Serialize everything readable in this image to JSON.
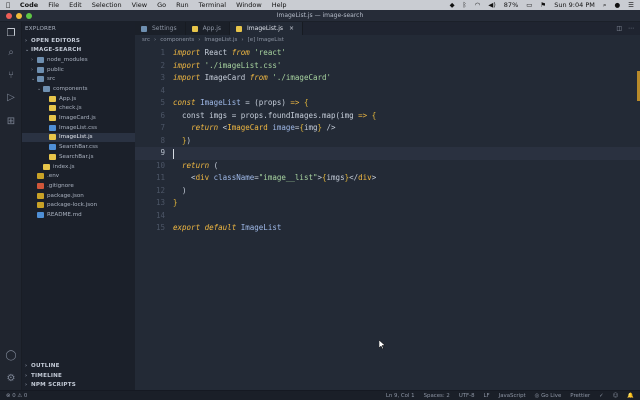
{
  "menubar": {
    "items": [
      "Code",
      "File",
      "Edit",
      "Selection",
      "View",
      "Go",
      "Run",
      "Terminal",
      "Window",
      "Help"
    ],
    "status": {
      "battery": "87%",
      "clock": "Sun 9:04 PM"
    }
  },
  "window": {
    "title": "ImageList.js — image-search"
  },
  "sidebar": {
    "explorer_title": "EXPLORER",
    "open_editors": "OPEN EDITORS",
    "project": "IMAGE-SEARCH",
    "tree": [
      {
        "label": "node_modules",
        "type": "folder",
        "depth": 1,
        "open": false,
        "color": "#6e8fb0"
      },
      {
        "label": "public",
        "type": "folder",
        "depth": 1,
        "open": false,
        "color": "#6e8fb0"
      },
      {
        "label": "src",
        "type": "folder",
        "depth": 1,
        "open": true,
        "color": "#6e8fb0"
      },
      {
        "label": "components",
        "type": "folder",
        "depth": 2,
        "open": true,
        "color": "#6e8fb0"
      },
      {
        "label": "App.js",
        "type": "js",
        "depth": 3,
        "color": "#e7c54a"
      },
      {
        "label": "check.js",
        "type": "js",
        "depth": 3,
        "color": "#e7c54a"
      },
      {
        "label": "ImageCard.js",
        "type": "js",
        "depth": 3,
        "color": "#e7c54a"
      },
      {
        "label": "ImageList.css",
        "type": "css",
        "depth": 3,
        "color": "#4f8fd6"
      },
      {
        "label": "ImageList.js",
        "type": "js",
        "depth": 3,
        "color": "#e7c54a",
        "selected": true
      },
      {
        "label": "SearchBar.css",
        "type": "css",
        "depth": 3,
        "color": "#4f8fd6"
      },
      {
        "label": "SearchBar.js",
        "type": "js",
        "depth": 3,
        "color": "#e7c54a"
      },
      {
        "label": "index.js",
        "type": "js",
        "depth": 2,
        "color": "#e7c54a"
      },
      {
        "label": ".env",
        "type": "env",
        "depth": 1,
        "color": "#c9a227"
      },
      {
        "label": ".gitignore",
        "type": "git",
        "depth": 1,
        "color": "#d0573a"
      },
      {
        "label": "package.json",
        "type": "json",
        "depth": 1,
        "color": "#c9a227"
      },
      {
        "label": "package-lock.json",
        "type": "json",
        "depth": 1,
        "color": "#c9a227"
      },
      {
        "label": "README.md",
        "type": "md",
        "depth": 1,
        "color": "#4f8fd6"
      }
    ],
    "bottom_sections": [
      "OUTLINE",
      "TIMELINE",
      "NPM SCRIPTS"
    ]
  },
  "tabs": [
    {
      "label": "Settings",
      "icon_color": "#6e8fb0",
      "active": false
    },
    {
      "label": "App.js",
      "icon_color": "#e7c54a",
      "active": false
    },
    {
      "label": "ImageList.js",
      "icon_color": "#e7c54a",
      "active": true
    }
  ],
  "breadcrumb": [
    "src",
    "›",
    "components",
    "›",
    "ImageList.js",
    "›",
    "[e] ImageList"
  ],
  "editor": {
    "lines": [
      {
        "n": "1",
        "html": "<span class='kw'>import</span> React <span class='kw'>from</span> <span class='str'>'react'</span>"
      },
      {
        "n": "2",
        "html": "<span class='kw'>import</span> <span class='str'>'./imageList.css'</span>"
      },
      {
        "n": "3",
        "html": "<span class='kw'>import</span> ImageCard <span class='kw'>from</span> <span class='str'>'./imageCard'</span>"
      },
      {
        "n": "4",
        "html": ""
      },
      {
        "n": "5",
        "html": "<span class='kw'>const</span> <span class='attr'>ImageList</span> = (props) <span class='kw'>=&gt;</span> <span class='bracket'>{</span>"
      },
      {
        "n": "6",
        "html": "  const imgs = props.foundImages.map(img <span class='kw'>=&gt;</span> <span class='bracket'>{</span>"
      },
      {
        "n": "7",
        "html": "    <span class='kw'>return</span> &lt;<span class='tag'>ImageCard</span> <span class='attr'>image</span>=<span class='bracket'>{</span>img<span class='bracket'>}</span> /&gt;"
      },
      {
        "n": "8",
        "html": "  <span class='bracket'>}</span>)"
      },
      {
        "n": "9",
        "html": "",
        "current": true
      },
      {
        "n": "10",
        "html": "  <span class='kw'>return</span> ("
      },
      {
        "n": "11",
        "html": "    &lt;<span class='tag'>div</span> <span class='attr'>className</span>=<span class='str'>\"image__list\"</span>&gt;<span class='bracket'>{</span>imgs<span class='bracket'>}</span>&lt;/<span class='tag'>div</span>&gt;"
      },
      {
        "n": "12",
        "html": "  )"
      },
      {
        "n": "13",
        "html": "<span class='bracket'>}</span>"
      },
      {
        "n": "14",
        "html": ""
      },
      {
        "n": "15",
        "html": "<span class='kw'>export</span> <span class='kw'>default</span> <span class='attr'>ImageList</span>"
      }
    ]
  },
  "statusbar": {
    "left": "⊗ 0  ⚠ 0",
    "right": [
      "Ln 9, Col 1",
      "Spaces: 2",
      "UTF-8",
      "LF",
      "JavaScript",
      "◎ Go Live",
      "Prettier",
      "✓",
      "☺",
      "🔔"
    ]
  },
  "colors": {
    "accent": "#f0b842",
    "bg": "#232a36",
    "sidebar": "#1b202a"
  }
}
